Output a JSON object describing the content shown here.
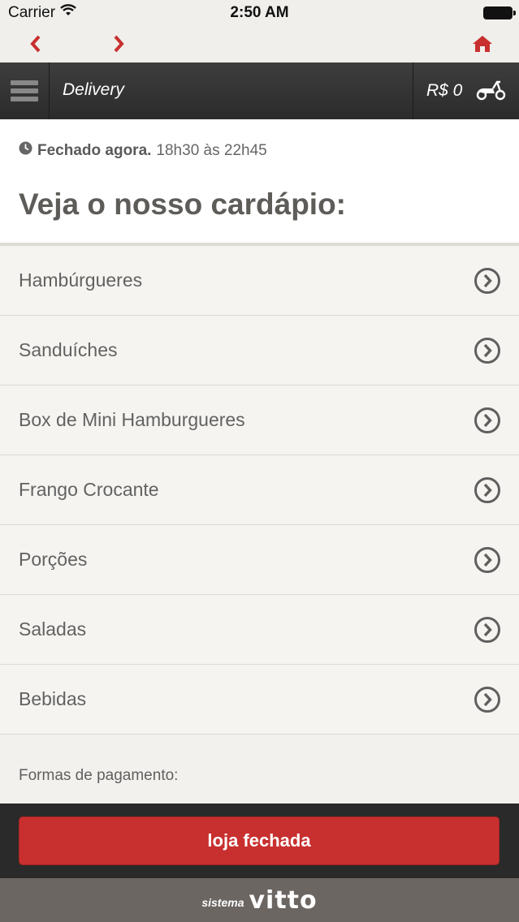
{
  "status_bar": {
    "carrier": "Carrier",
    "time": "2:50 AM"
  },
  "nav": {
    "back_icon": "chevron-left-icon",
    "forward_icon": "chevron-right-icon",
    "home_icon": "home-icon",
    "accent_color": "#c8302f"
  },
  "header": {
    "title": "Delivery",
    "cart_total": "R$ 0",
    "menu_icon": "hamburger-menu-icon",
    "cart_icon": "scooter-icon"
  },
  "store": {
    "status_label": "Fechado agora.",
    "hours": "18h30 às 22h45",
    "menu_heading": "Veja o nosso cardápio:"
  },
  "categories": [
    "Hambúrgueres",
    "Sanduíches",
    "Box de Mini Hamburgueres",
    "Frango Crocante",
    "Porções",
    "Saladas",
    "Bebidas"
  ],
  "payment_label": "Formas de pagamento:",
  "footer": {
    "closed_button": "loja fechada",
    "button_color": "#c8302f"
  },
  "brand": {
    "prefix": "sistema",
    "name": "vitto"
  }
}
